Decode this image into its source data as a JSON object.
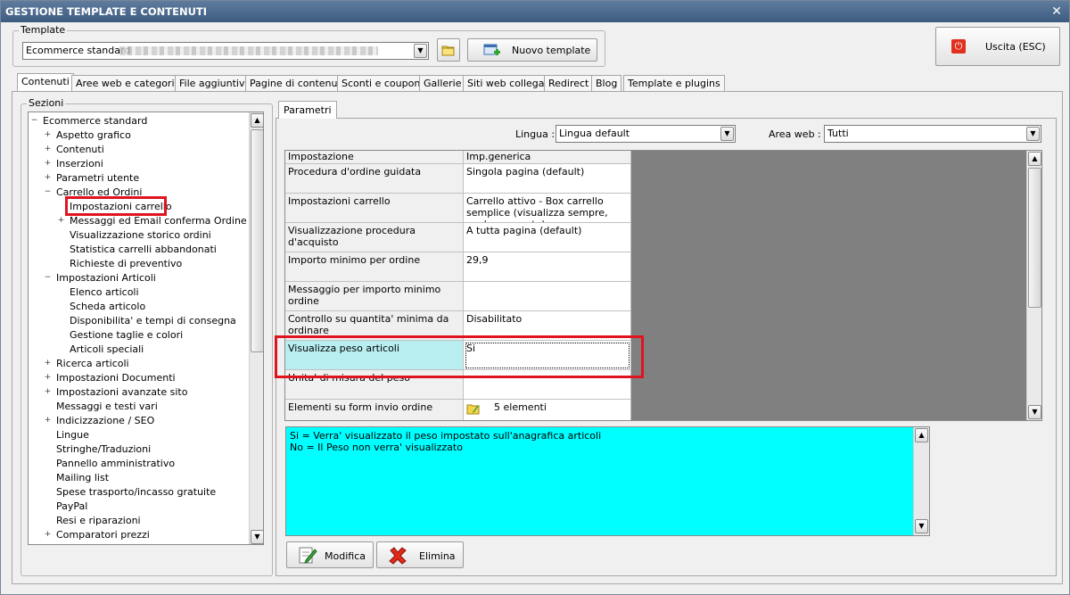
{
  "window": {
    "title": "GESTIONE TEMPLATE E CONTENUTI",
    "close_glyph": "✕"
  },
  "template_group": {
    "label": "Template",
    "selected": "Ecommerce standard",
    "folder_icon": "folder-icon",
    "new_template_label": "Nuovo template"
  },
  "exit_button": {
    "label": "Uscita (ESC)",
    "icon": "power-icon",
    "accent": "#e03020"
  },
  "tabs": [
    "Contenuti",
    "Aree web e categorie",
    "File aggiuntivi",
    "Pagine di contenuti",
    "Sconti e coupon",
    "Gallerie",
    "Siti web collegati",
    "Redirect",
    "Blog",
    "Template e plugins"
  ],
  "sections": {
    "label": "Sezioni",
    "items": [
      {
        "label": "Ecommerce standard",
        "exp": "−"
      },
      {
        "label": "Aspetto grafico",
        "exp": "+"
      },
      {
        "label": "Contenuti",
        "exp": "+"
      },
      {
        "label": "Inserzioni",
        "exp": "+"
      },
      {
        "label": "Parametri utente",
        "exp": "+"
      },
      {
        "label": "Carrello ed Ordini",
        "exp": "−"
      },
      {
        "label": "Impostazioni carrello",
        "exp": ""
      },
      {
        "label": "Messaggi ed Email conferma Ordine",
        "exp": "+"
      },
      {
        "label": "Visualizzazione storico ordini",
        "exp": ""
      },
      {
        "label": "Statistica carrelli abbandonati",
        "exp": ""
      },
      {
        "label": "Richieste di preventivo",
        "exp": ""
      },
      {
        "label": "Impostazioni Articoli",
        "exp": "−"
      },
      {
        "label": "Elenco articoli",
        "exp": ""
      },
      {
        "label": "Scheda articolo",
        "exp": ""
      },
      {
        "label": "Disponibilita' e tempi di consegna",
        "exp": ""
      },
      {
        "label": "Gestione taglie e colori",
        "exp": ""
      },
      {
        "label": "Articoli speciali",
        "exp": ""
      },
      {
        "label": "Ricerca articoli",
        "exp": "+"
      },
      {
        "label": "Impostazioni Documenti",
        "exp": "+"
      },
      {
        "label": "Impostazioni avanzate sito",
        "exp": "+"
      },
      {
        "label": "Messaggi e testi vari",
        "exp": ""
      },
      {
        "label": "Indicizzazione / SEO",
        "exp": "+"
      },
      {
        "label": "Lingue",
        "exp": ""
      },
      {
        "label": "Stringhe/Traduzioni",
        "exp": ""
      },
      {
        "label": "Pannello amministrativo",
        "exp": ""
      },
      {
        "label": "Mailing list",
        "exp": ""
      },
      {
        "label": "Spese trasporto/incasso gratuite",
        "exp": ""
      },
      {
        "label": "PayPal",
        "exp": ""
      },
      {
        "label": "Resi e riparazioni",
        "exp": ""
      },
      {
        "label": "Comparatori prezzi",
        "exp": "+"
      }
    ]
  },
  "params": {
    "tab_label": "Parametri",
    "lingua_label": "Lingua :",
    "lingua_value": "Lingua default",
    "area_label": "Area web :",
    "area_value": "Tutti",
    "headers": {
      "setting": "Impostazione",
      "value": "Imp.generica"
    },
    "rows": [
      {
        "setting": "Procedura d'ordine guidata",
        "value": "Singola pagina (default)"
      },
      {
        "setting": "Impostazioni carrello",
        "value": "Carrello attivo - Box carrello semplice (visualizza sempre, anche se vuoto)"
      },
      {
        "setting": "Visualizzazione procedura d'acquisto",
        "value": "A tutta pagina (default)"
      },
      {
        "setting": "Importo minimo per ordine",
        "value": "29,9"
      },
      {
        "setting": "Messaggio per importo minimo ordine",
        "value": ""
      },
      {
        "setting": "Controllo su quantita' minima da ordinare",
        "value": "Disabilitato"
      },
      {
        "setting": "Visualizza peso articoli",
        "value": "Si"
      },
      {
        "setting": "Unita' di misura del peso",
        "value": ""
      },
      {
        "setting": "Elementi su form invio ordine",
        "value": "5 elementi"
      }
    ],
    "selected_color": "#b8eef0"
  },
  "description": {
    "line1": "Si = Verra' visualizzato il peso impostato sull'anagrafica articoli",
    "line2": "No = Il Peso non verra' visualizzato",
    "bg": "#00ffff"
  },
  "actions": {
    "edit": "Modifica",
    "delete": "Elimina"
  }
}
